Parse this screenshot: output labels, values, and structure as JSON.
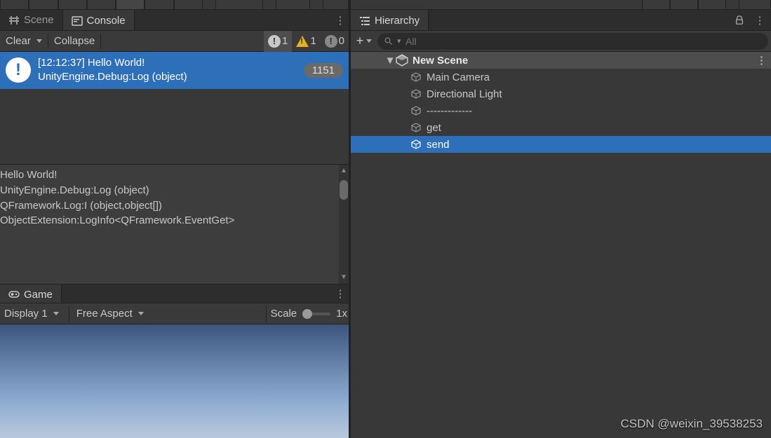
{
  "tabs_left": {
    "scene": "Scene",
    "console": "Console",
    "game": "Game"
  },
  "tabs_right": {
    "hierarchy": "Hierarchy"
  },
  "console_toolbar": {
    "clear": "Clear",
    "collapse": "Collapse"
  },
  "console_counts": {
    "info": "1",
    "warn": "1",
    "error": "0"
  },
  "console_entry": {
    "line1": "[12:12:37] Hello World!",
    "line2": "UnityEngine.Debug:Log (object)",
    "badge": "1151"
  },
  "console_detail": {
    "lines": [
      "Hello World!",
      "UnityEngine.Debug:Log (object)",
      "QFramework.Log:I (object,object[])",
      "ObjectExtension:LogInfo<QFramework.EventGet>"
    ]
  },
  "game_bar": {
    "display": "Display 1",
    "aspect": "Free Aspect",
    "scale_label": "Scale",
    "scale_value": "1x"
  },
  "hierarchy": {
    "search_prefix": "All",
    "scene": "New Scene",
    "items": [
      {
        "label": "Main Camera"
      },
      {
        "label": "Directional Light"
      },
      {
        "label": "-------------"
      },
      {
        "label": "get"
      },
      {
        "label": "send"
      }
    ]
  },
  "watermark": "CSDN @weixin_39538253"
}
